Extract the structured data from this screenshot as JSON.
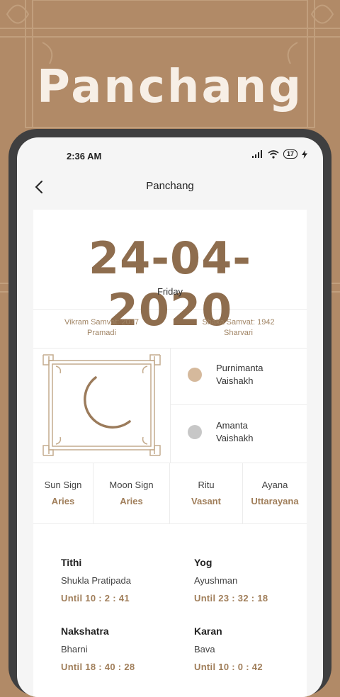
{
  "promo": {
    "title": "Panchang"
  },
  "status_bar": {
    "time": "2:36 AM",
    "battery": "17"
  },
  "app_bar": {
    "title": "Panchang"
  },
  "date": {
    "value": "24-04-2020",
    "weekday": "Friday"
  },
  "samvat": {
    "vikram": "Vikram Samvat: 2077",
    "vikram_name": "Pramadi",
    "shaka": "Shaka Samvat: 1942",
    "shaka_name": "Sharvari"
  },
  "months": [
    {
      "line1": "Purnimanta",
      "line2": "Vaishakh",
      "color": "#d5b99c"
    },
    {
      "line1": "Amanta",
      "line2": "Vaishakh",
      "color": "#c7c7c7"
    }
  ],
  "signs": [
    {
      "label": "Sun Sign",
      "value": "Aries"
    },
    {
      "label": "Moon Sign",
      "value": "Aries"
    },
    {
      "label": "Ritu",
      "value": "Vasant"
    },
    {
      "label": "Ayana",
      "value": "Uttarayana"
    }
  ],
  "details": [
    {
      "title": "Tithi",
      "name": "Shukla Pratipada",
      "until": "Until 10 : 2 : 41"
    },
    {
      "title": "Yog",
      "name": "Ayushman",
      "until": "Until 23 : 32 : 18"
    },
    {
      "title": "Nakshatra",
      "name": "Bharni",
      "until": "Until 18 : 40 : 28"
    },
    {
      "title": "Karan",
      "name": "Bava",
      "until": "Until 10 : 0 : 42"
    }
  ],
  "colors": {
    "brand": "#b18a67",
    "accent": "#8e6d4e",
    "value_text": "#a07e5a"
  }
}
